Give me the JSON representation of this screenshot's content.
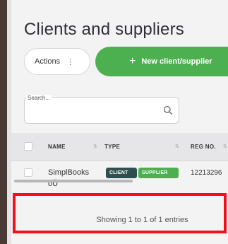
{
  "page": {
    "title": "Clients and suppliers"
  },
  "toolbar": {
    "actions_label": "Actions",
    "new_label": "New client/supplier"
  },
  "search": {
    "legend": "Search...",
    "value": ""
  },
  "table": {
    "columns": [
      "NAME",
      "TYPE",
      "REG NO."
    ],
    "rows": [
      {
        "name_line1": "SimplBooks",
        "name_line2": "oÜ",
        "types": [
          "CLIENT",
          "SUPPLIER"
        ],
        "reg_no": "12213296"
      }
    ]
  },
  "footer": {
    "info": "Showing 1 to 1 of 1 entries"
  },
  "colors": {
    "accent": "#4caf50",
    "client_badge": "#2f4f4f",
    "highlight": "#f3101b",
    "sidebar": "#4a3a35"
  }
}
